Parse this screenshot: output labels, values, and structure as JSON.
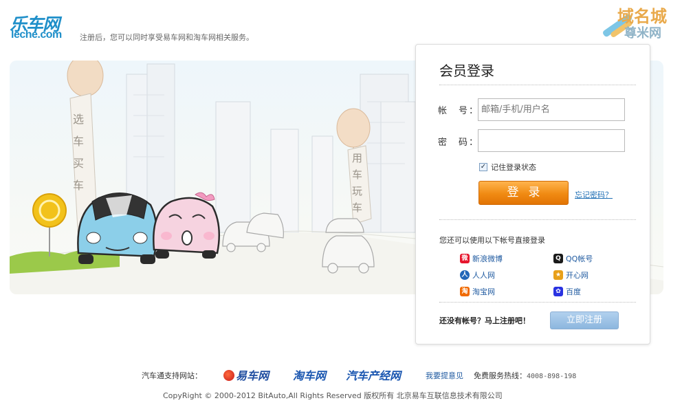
{
  "header": {
    "logo_cn": "乐车网",
    "logo_en": "leche.com",
    "tagline": "注册后，您可以同时享受易车网和淘车网相关服务。",
    "watermark_line1": "域名城",
    "watermark_line2": "尊米网"
  },
  "banner": {
    "flag_left": "选车买车",
    "flag_right": "用车玩车"
  },
  "login": {
    "title": "会员登录",
    "account_label": "帐　号：",
    "account_placeholder": "邮箱/手机/用户名",
    "password_label": "密　码：",
    "password_value": "",
    "remember_label": "记住登录状态",
    "remember_checked": true,
    "login_button": "登录",
    "forgot_link": "忘记密码？",
    "alt_login_text": "您还可以使用以下帐号直接登录",
    "social": [
      {
        "label": "新浪微博",
        "icon": "weibo-icon",
        "color": "#e6162d"
      },
      {
        "label": "QQ帐号",
        "icon": "qq-icon",
        "color": "#1a1a1a"
      },
      {
        "label": "人人网",
        "icon": "renren-icon",
        "color": "#2266b8"
      },
      {
        "label": "开心网",
        "icon": "kaixin-icon",
        "color": "#e8a01a"
      },
      {
        "label": "淘宝网",
        "icon": "taobao-icon",
        "color": "#f06a00"
      },
      {
        "label": "百度",
        "icon": "baidu-icon",
        "color": "#2932e1"
      }
    ],
    "register_prompt": "还没有帐号？马上注册吧！",
    "register_button": "立即注册"
  },
  "footer": {
    "partners_label": "汽车通支持网站：",
    "partners": [
      "易车网",
      "淘车网",
      "汽车产经网"
    ],
    "feedback_link": "我要提意见",
    "hotline_label": "免费服务热线：",
    "hotline_number": "4008-898-198",
    "copyright": "CopyRight © 2000-2012 BitAuto,All Rights Reserved 版权所有 北京易车互联信息技术有限公司"
  },
  "colors": {
    "brand_blue": "#1f8fc9",
    "login_orange": "#f08a12",
    "register_blue": "#8cb6de"
  }
}
